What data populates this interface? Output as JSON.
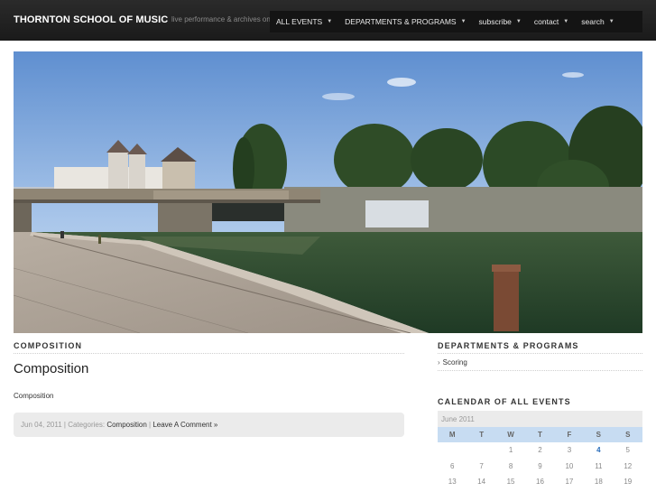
{
  "header": {
    "site_title": "THORNTON SCHOOL OF MUSIC",
    "tagline": "live performance & archives on"
  },
  "nav": [
    {
      "label": "ALL EVENTS"
    },
    {
      "label": "DEPARTMENTS & PROGRAMS"
    },
    {
      "label": "subscribe"
    },
    {
      "label": "contact"
    },
    {
      "label": "search"
    }
  ],
  "post": {
    "category_heading": "COMPOSITION",
    "title": "Composition",
    "body": "Composition",
    "meta": {
      "date": "Jun 04, 2011",
      "separator1": " | Categories: ",
      "category_link": "Composition",
      "separator2": " | ",
      "comment_link": "Leave A Comment »"
    }
  },
  "sidebar": {
    "departments_heading": "DEPARTMENTS & PROGRAMS",
    "departments_items": [
      {
        "label": "Scoring"
      }
    ],
    "calendar_heading": "CALENDAR OF ALL EVENTS",
    "calendar": {
      "caption": "June 2011",
      "weekdays": [
        "M",
        "T",
        "W",
        "T",
        "F",
        "S",
        "S"
      ],
      "rows": [
        [
          "",
          "",
          "1",
          "2",
          "3",
          "4",
          "5"
        ],
        [
          "6",
          "7",
          "8",
          "9",
          "10",
          "11",
          "12"
        ],
        [
          "13",
          "14",
          "15",
          "16",
          "17",
          "18",
          "19"
        ]
      ],
      "linked_day": "4"
    }
  },
  "colors": {
    "header_bg": "#1f1f1f",
    "nav_bg": "#141414",
    "calendar_header_bg": "#c7dcf2",
    "link": "#2a6ebb"
  },
  "icons": {
    "nav_caret": "caret-down-icon",
    "list_bullet": "chevron-right-icon"
  }
}
